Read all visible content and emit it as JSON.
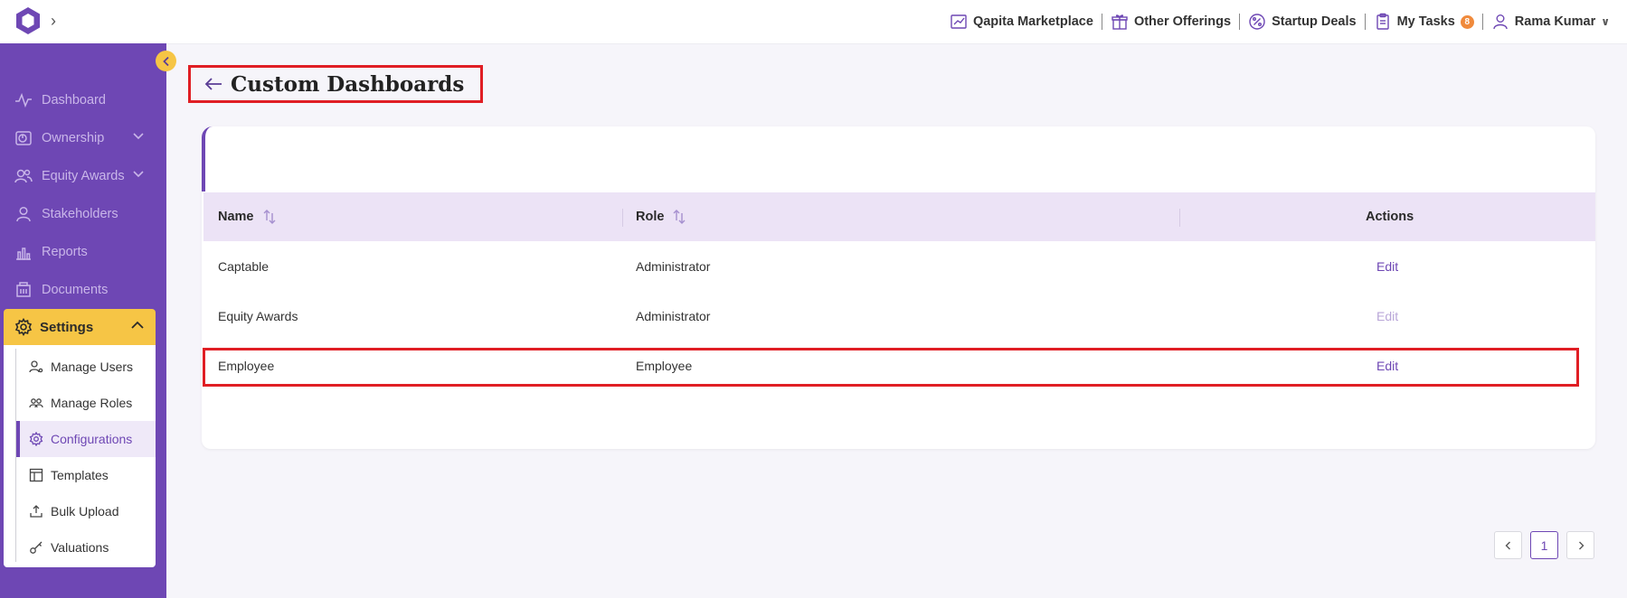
{
  "topbar": {
    "nav": [
      {
        "label": "Qapita Marketplace",
        "icon": "chart-icon"
      },
      {
        "label": "Other Offerings",
        "icon": "gift-icon"
      },
      {
        "label": "Startup Deals",
        "icon": "percent-badge-icon"
      },
      {
        "label": "My Tasks",
        "icon": "clipboard-icon",
        "badge": "8"
      },
      {
        "label": "Rama Kumar",
        "icon": "user-icon"
      }
    ]
  },
  "sidebar": {
    "items": [
      {
        "label": "Dashboard"
      },
      {
        "label": "Ownership"
      },
      {
        "label": "Equity Awards"
      },
      {
        "label": "Stakeholders"
      },
      {
        "label": "Reports"
      },
      {
        "label": "Documents"
      }
    ],
    "settings": {
      "label": "Settings"
    },
    "subitems": [
      {
        "label": "Manage Users"
      },
      {
        "label": "Manage Roles"
      },
      {
        "label": "Configurations"
      },
      {
        "label": "Templates"
      },
      {
        "label": "Bulk Upload"
      },
      {
        "label": "Valuations"
      }
    ]
  },
  "page": {
    "title": "Custom Dashboards"
  },
  "table": {
    "headers": {
      "name": "Name",
      "role": "Role",
      "actions": "Actions"
    },
    "rows": [
      {
        "name": "Captable",
        "role": "Administrator",
        "action": "Edit"
      },
      {
        "name": "Equity Awards",
        "role": "Administrator",
        "action": "Edit"
      },
      {
        "name": "Employee",
        "role": "Employee",
        "action": "Edit"
      }
    ]
  },
  "pagination": {
    "current": "1"
  },
  "colors": {
    "brand": "#6e47b4",
    "accent": "#f6c545",
    "highlight": "#e01e24",
    "badge": "#f08a3c"
  }
}
